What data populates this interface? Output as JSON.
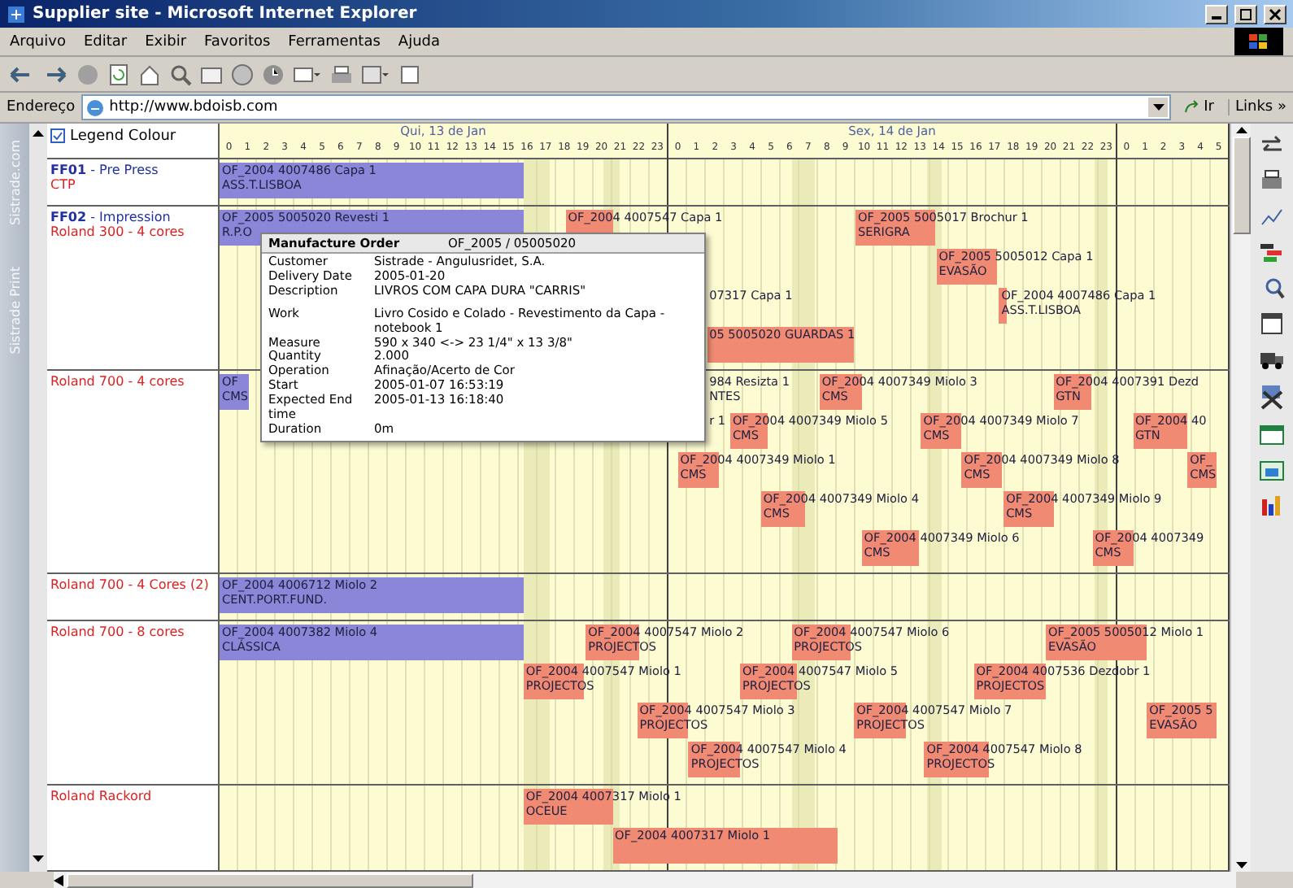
{
  "window": {
    "title": "Supplier site - Microsoft Internet Explorer"
  },
  "menu": [
    "Arquivo",
    "Editar",
    "Exibir",
    "Favoritos",
    "Ferramentas",
    "Ajuda"
  ],
  "address": {
    "label": "Endereço",
    "value": "http://www.bdoisb.com",
    "go": "Ir",
    "links": "Links »"
  },
  "side_tabs": [
    {
      "label": "Sistrade.com",
      "selected": false
    },
    {
      "label": "Sistrade Print",
      "selected": false
    }
  ],
  "legend": {
    "label": "Legend Colour",
    "checked": true
  },
  "timeline": {
    "days": [
      {
        "label": "Qui, 13 de Jan",
        "hours": [
          "0",
          "1",
          "2",
          "3",
          "4",
          "5",
          "6",
          "7",
          "8",
          "9",
          "10",
          "11",
          "12",
          "13",
          "14",
          "15",
          "16",
          "17",
          "18",
          "19",
          "20",
          "21",
          "22",
          "23"
        ]
      },
      {
        "label": "Sex, 14 de Jan",
        "hours": [
          "0",
          "1",
          "2",
          "3",
          "4",
          "5",
          "6",
          "7",
          "8",
          "9",
          "10",
          "11",
          "12",
          "13",
          "14",
          "15",
          "16",
          "17",
          "18",
          "19",
          "20",
          "21",
          "22",
          "23"
        ]
      },
      {
        "hours": [
          "0",
          "1",
          "2",
          "3",
          "4",
          "5"
        ]
      }
    ]
  },
  "rows": [
    {
      "group": "**FF01** - Pre Press",
      "resource": "CTP",
      "lanes": [
        [
          {
            "order": "OF_2004 4007486 Capa 1",
            "client": "ASS.T.LISBOA",
            "color": "#8a86d8"
          }
        ]
      ]
    },
    {
      "group": "**FF02** - Impression",
      "resource": "Roland 300 - 4 cores",
      "lanes": [
        [
          {
            "order": "OF_2005 5005020 Revesti 1",
            "client": "R.P.O",
            "color": "#8a86d8"
          },
          {
            "order": "OF_2004 4007547 Capa 1",
            "color": "#f08a72"
          },
          {
            "order": "OF_2005 5005017 Brochur 1",
            "client": "SERIGRA",
            "color": "#f08a72"
          }
        ],
        [
          {
            "order": "OF_2005 5005012 Capa 1",
            "client": "EVASÃO",
            "color": "#f08a72"
          }
        ],
        [
          {
            "order": "07317 Capa 1"
          },
          {
            "order": "OF_2004 4007486 Capa 1",
            "client": "ASS.T.LISBOA",
            "color": "#f08a72"
          }
        ],
        [
          {
            "order": "05 5005020 GUARDAS 1",
            "color": "#f08a72"
          }
        ]
      ]
    },
    {
      "resource": "Roland 700 - 4 cores",
      "lanes": [
        [
          {
            "order": "OF",
            "client": "CMS",
            "color": "#8a86d8"
          },
          {
            "order": "984 Resizta 1",
            "client": "NTES"
          },
          {
            "order": "OF_2004 4007349 Miolo 3",
            "client": "CMS",
            "color": "#f08a72"
          },
          {
            "order": "OF_2004 4007391 Dezd",
            "client": "GTN",
            "color": "#f08a72"
          }
        ],
        [
          {
            "order": "r 1"
          },
          {
            "order": "OF_2004 4007349 Miolo 5",
            "client": "CMS",
            "color": "#f08a72"
          },
          {
            "order": "OF_2004 4007349 Miolo 7",
            "client": "CMS",
            "color": "#f08a72"
          },
          {
            "order": "OF_2004 40",
            "client": "GTN",
            "color": "#f08a72"
          }
        ],
        [
          {
            "order": "OF_2004 4007349 Miolo 1",
            "client": "CMS",
            "color": "#f08a72"
          },
          {
            "order": "OF_2004 4007349 Miolo 8",
            "client": "CMS",
            "color": "#f08a72"
          },
          {
            "order": "OF_",
            "client": "CMS",
            "color": "#f08a72"
          }
        ],
        [
          {
            "order": "OF_2004 4007349 Miolo 4",
            "client": "CMS",
            "color": "#f08a72"
          },
          {
            "order": "OF_2004 4007349 Miolo 9",
            "client": "CMS",
            "color": "#f08a72"
          }
        ],
        [
          {
            "order": "OF_2004 4007349 Miolo 6",
            "client": "CMS",
            "color": "#f08a72"
          },
          {
            "order": "OF_2004 4007349",
            "client": "CMS",
            "color": "#f08a72"
          }
        ]
      ]
    },
    {
      "resource": "Roland 700 - 4 Cores (2)",
      "lanes": [
        [
          {
            "order": "OF_2004 4006712 Miolo 2",
            "client": "CENT.PORT.FUND.",
            "color": "#8a86d8"
          }
        ]
      ]
    },
    {
      "resource": "Roland 700 - 8 cores",
      "lanes": [
        [
          {
            "order": "OF_2004 4007382 Miolo 4",
            "client": "CLÁSSICA",
            "color": "#8a86d8"
          },
          {
            "order": "OF_2004 4007547 Miolo 2",
            "client": "PROJECTOS",
            "color": "#f08a72"
          },
          {
            "order": "OF_2004 4007547 Miolo 6",
            "client": "PROJECTOS",
            "color": "#f08a72"
          },
          {
            "order": "OF_2005 5005012 Miolo 1",
            "client": "EVASÃO",
            "color": "#f08a72"
          }
        ],
        [
          {
            "order": "OF_2004 4007547 Miolo 1",
            "client": "PROJECTOS",
            "color": "#f08a72"
          },
          {
            "order": "OF_2004 4007547 Miolo 5",
            "client": "PROJECTOS",
            "color": "#f08a72"
          },
          {
            "order": "OF_2004 4007536 Dezdobr 1",
            "client": "PROJECTOS",
            "color": "#f08a72"
          }
        ],
        [
          {
            "order": "OF_2004 4007547 Miolo 3",
            "client": "PROJECTOS",
            "color": "#f08a72"
          },
          {
            "order": "OF_2004 4007547 Miolo 7",
            "client": "PROJECTOS",
            "color": "#f08a72"
          },
          {
            "order": "OF_2005 5",
            "client": "EVASÃO",
            "color": "#f08a72"
          }
        ],
        [
          {
            "order": "OF_2004 4007547 Miolo 4",
            "client": "PROJECTOS",
            "color": "#f08a72"
          },
          {
            "order": "OF_2004 4007547 Miolo 8",
            "client": "PROJECTOS",
            "color": "#f08a72"
          }
        ]
      ]
    },
    {
      "resource": "Roland Rackord",
      "lanes": [
        [
          {
            "order": "OF_2004 4007317 Miolo 1",
            "client": "OCEUE",
            "color": "#f08a72"
          }
        ],
        [
          {
            "order": "OF_2004 4007317 Miolo 1",
            "color": "#f08a72"
          }
        ]
      ]
    }
  ],
  "tooltip": {
    "title": "Manufacture Order",
    "order": "OF_2005 / 05005020",
    "fields": [
      {
        "label": "Customer",
        "value": "Sistrade - Angulusridet, S.A."
      },
      {
        "label": "Delivery Date",
        "value": "2005-01-20"
      },
      {
        "label": "Description",
        "value": "LIVROS COM CAPA DURA \"CARRIS\""
      },
      {
        "label": "Work",
        "value": "Livro Cosido e Colado - Revestimento da Capa - notebook 1"
      },
      {
        "label": "Measure",
        "value": "590 x 340  <->  23 1/4\" x 13 3/8\""
      },
      {
        "label": "Quantity",
        "value": "2.000"
      },
      {
        "label": "Operation",
        "value": "Afinação/Acerto de Cor"
      },
      {
        "label": "Start",
        "value": "2005-01-07 16:53:19"
      },
      {
        "label": "Expected End time",
        "value": "2005-01-13 16:18:40"
      },
      {
        "label": "Duration",
        "value": "0m"
      }
    ]
  }
}
